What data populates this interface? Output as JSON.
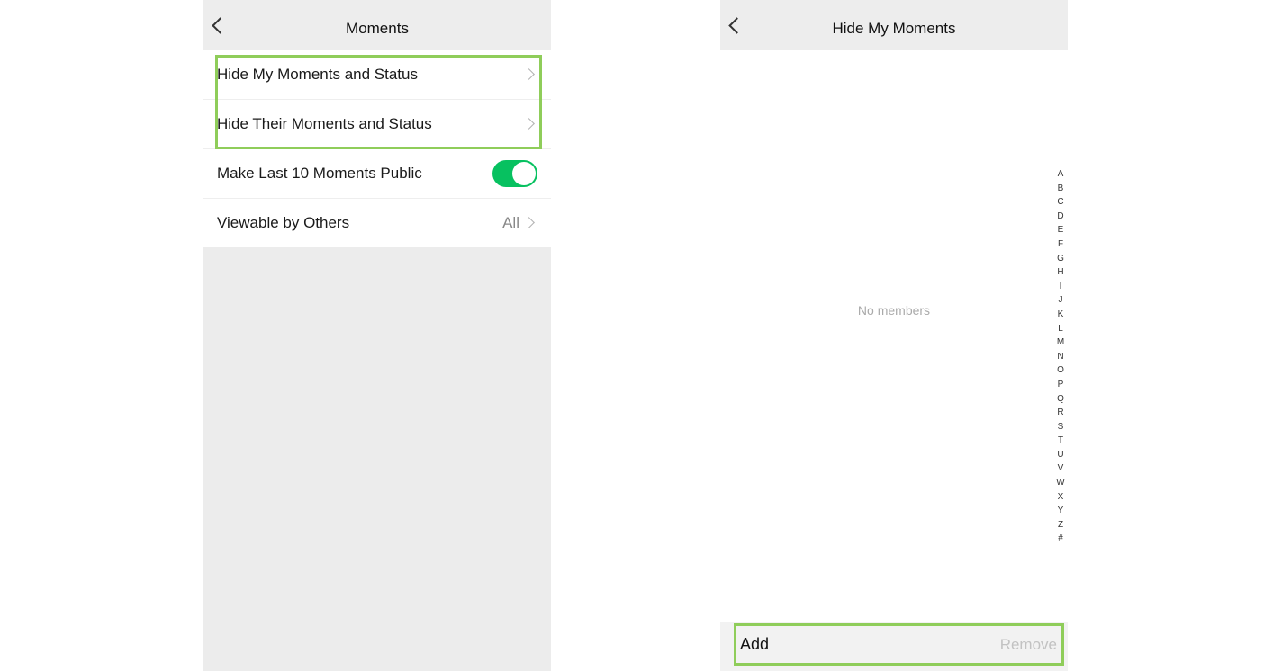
{
  "left_screen": {
    "title": "Moments",
    "rows": [
      {
        "label": "Hide My Moments and Status"
      },
      {
        "label": "Hide Their Moments and Status"
      },
      {
        "label": "Make Last 10 Moments Public",
        "toggle_on": true
      },
      {
        "label": "Viewable by Others",
        "value": "All"
      }
    ]
  },
  "right_screen": {
    "title": "Hide My Moments",
    "empty_text": "No members",
    "alphabet": [
      "A",
      "B",
      "C",
      "D",
      "E",
      "F",
      "G",
      "H",
      "I",
      "J",
      "K",
      "L",
      "M",
      "N",
      "O",
      "P",
      "Q",
      "R",
      "S",
      "T",
      "U",
      "V",
      "W",
      "X",
      "Y",
      "Z",
      "#"
    ],
    "add_label": "Add",
    "remove_label": "Remove"
  },
  "colors": {
    "toggle_on": "#07c160",
    "highlight": "#8fcd5a"
  }
}
